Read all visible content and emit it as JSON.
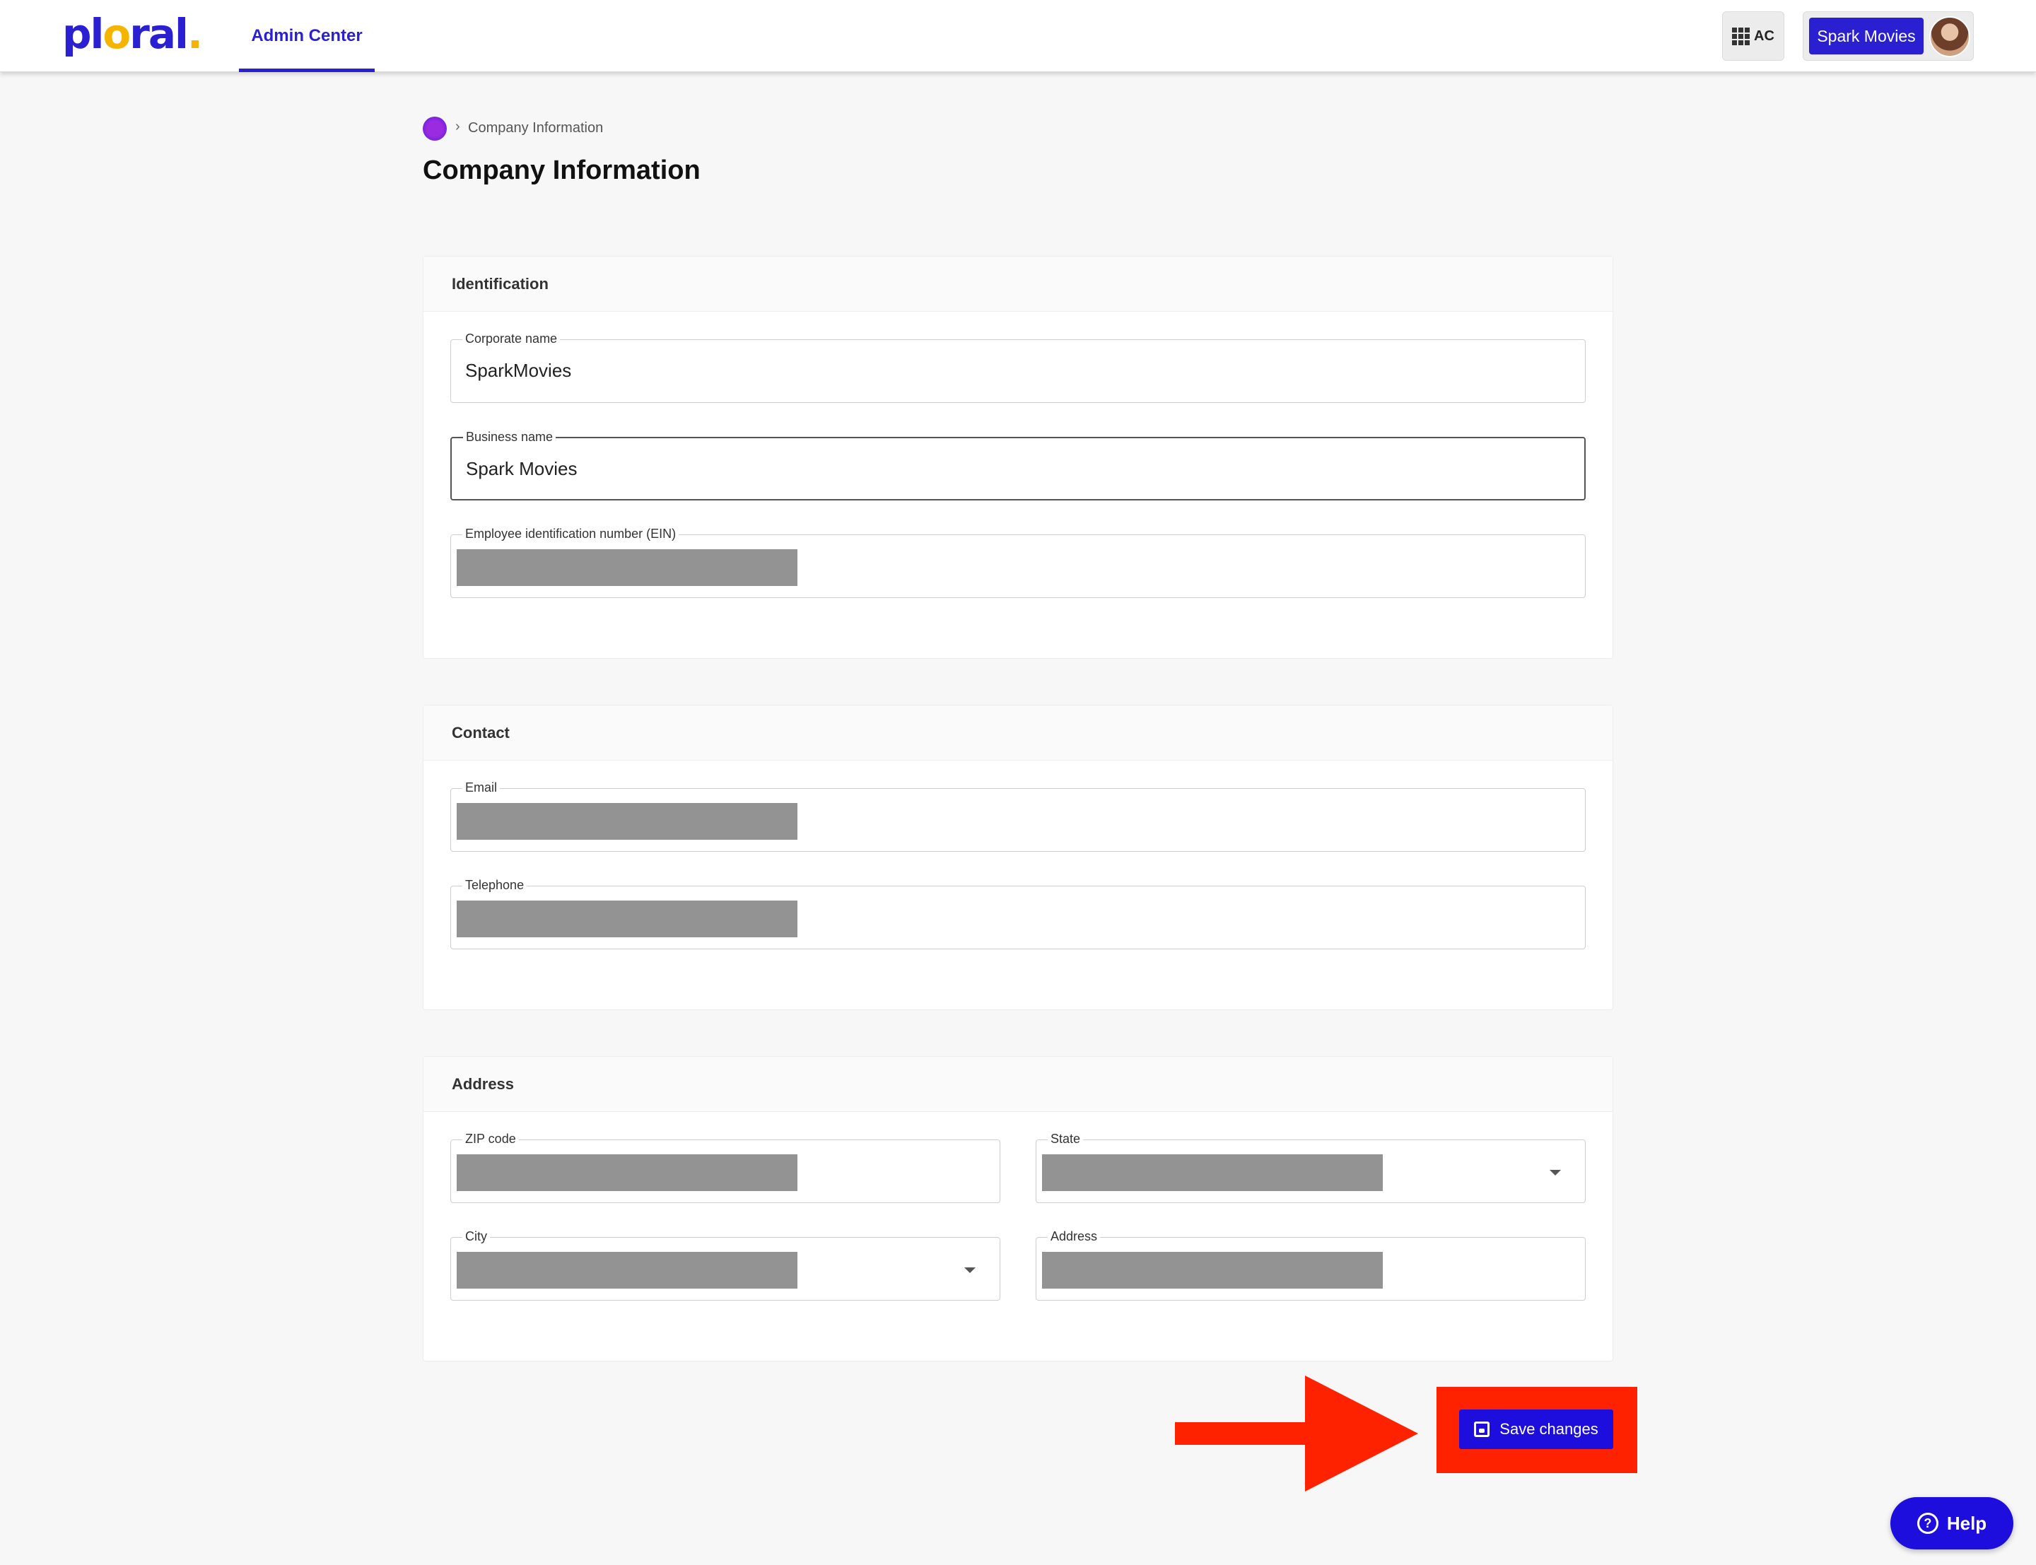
{
  "header": {
    "logo_text": "plural",
    "nav_tab_label": "Admin Center",
    "apps_button_label": "AC",
    "company_chip_label": "Spark Movies"
  },
  "breadcrumb": {
    "current": "Company Information"
  },
  "page_title": "Company Information",
  "identification": {
    "title": "Identification",
    "corporate_name_label": "Corporate name",
    "corporate_name_value": "SparkMovies",
    "business_name_label": "Business name",
    "business_name_value": "Spark Movies",
    "ein_label": "Employee identification number (EIN)"
  },
  "contact": {
    "title": "Contact",
    "email_label": "Email",
    "telephone_label": "Telephone"
  },
  "address": {
    "title": "Address",
    "zip_label": "ZIP code",
    "state_label": "State",
    "city_label": "City",
    "address_label": "Address"
  },
  "actions": {
    "save_label": "Save changes"
  },
  "help": {
    "label": "Help"
  },
  "colors": {
    "brand": "#2a1fd1",
    "highlight": "#ff2200",
    "redaction": "#939393"
  }
}
